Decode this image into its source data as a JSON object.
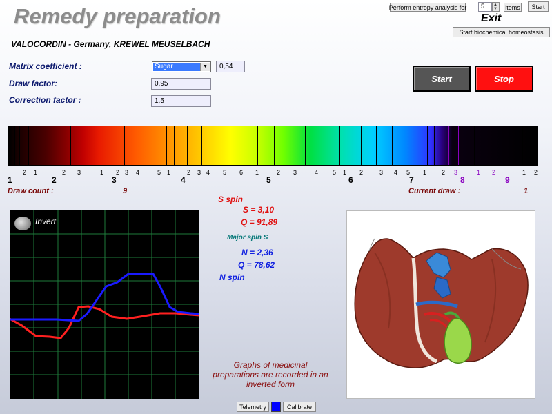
{
  "header": {
    "title": "Remedy preparation",
    "subtitle": "VALOCORDIN - Germany, KREWEL MEUSELBACH"
  },
  "entropy": {
    "perform_label": "Perform entropy analysis for",
    "count": "5",
    "items_label": "items",
    "start_label": "Start"
  },
  "exit_label": "Exit",
  "homeostasis_label": "Start biochemical homeostasis",
  "params": {
    "matrix_label": "Matrix coefficient :",
    "matrix_select": "Sugar",
    "matrix_value": "0,54",
    "draw_factor_label": "Draw factor:",
    "draw_factor_value": "0,95",
    "correction_label": "Correction factor :",
    "correction_value": "1,5"
  },
  "controls": {
    "start": "Start",
    "stop": "Stop",
    "start_color": "#555555",
    "stop_color": "#ff1010"
  },
  "spectrum": {
    "small_ticks": [
      "1",
      "2",
      "1",
      "2",
      "3",
      "1",
      "2",
      "3",
      "4",
      "5",
      "1",
      "2",
      "3",
      "4",
      "5",
      "6",
      "1",
      "2",
      "3",
      "4",
      "5",
      "1",
      "2",
      "3",
      "4",
      "5",
      "1",
      "2",
      "3",
      "1",
      "2",
      "1",
      "2"
    ],
    "big_ticks": [
      "1",
      "2",
      "3",
      "4",
      "5",
      "6",
      "7",
      "8",
      "9"
    ],
    "violet_color": "#8a00c0"
  },
  "draw": {
    "count_label": "Draw count :",
    "count_value": "9",
    "current_label": "Current draw :",
    "current_value": "1"
  },
  "graph": {
    "invert_label": "Invert",
    "grid_color": "#1e7a3a",
    "red_color": "#ff2020",
    "blue_color": "#1a1aff"
  },
  "spin": {
    "s_spin_label": "S spin",
    "s_value": "S = 3,10",
    "q1_value": "Q = 91,89",
    "major_label": "Major spin S",
    "n_value": "N = 2,36",
    "q2_value": "Q = 78,62",
    "n_spin_label": "N spin"
  },
  "note": "Graphs of medicinal preparations are recorded in an inverted form",
  "bottom": {
    "telemetry": "Telemetry",
    "calibrate": "Calibrate",
    "indicator_color": "#0000ff"
  }
}
